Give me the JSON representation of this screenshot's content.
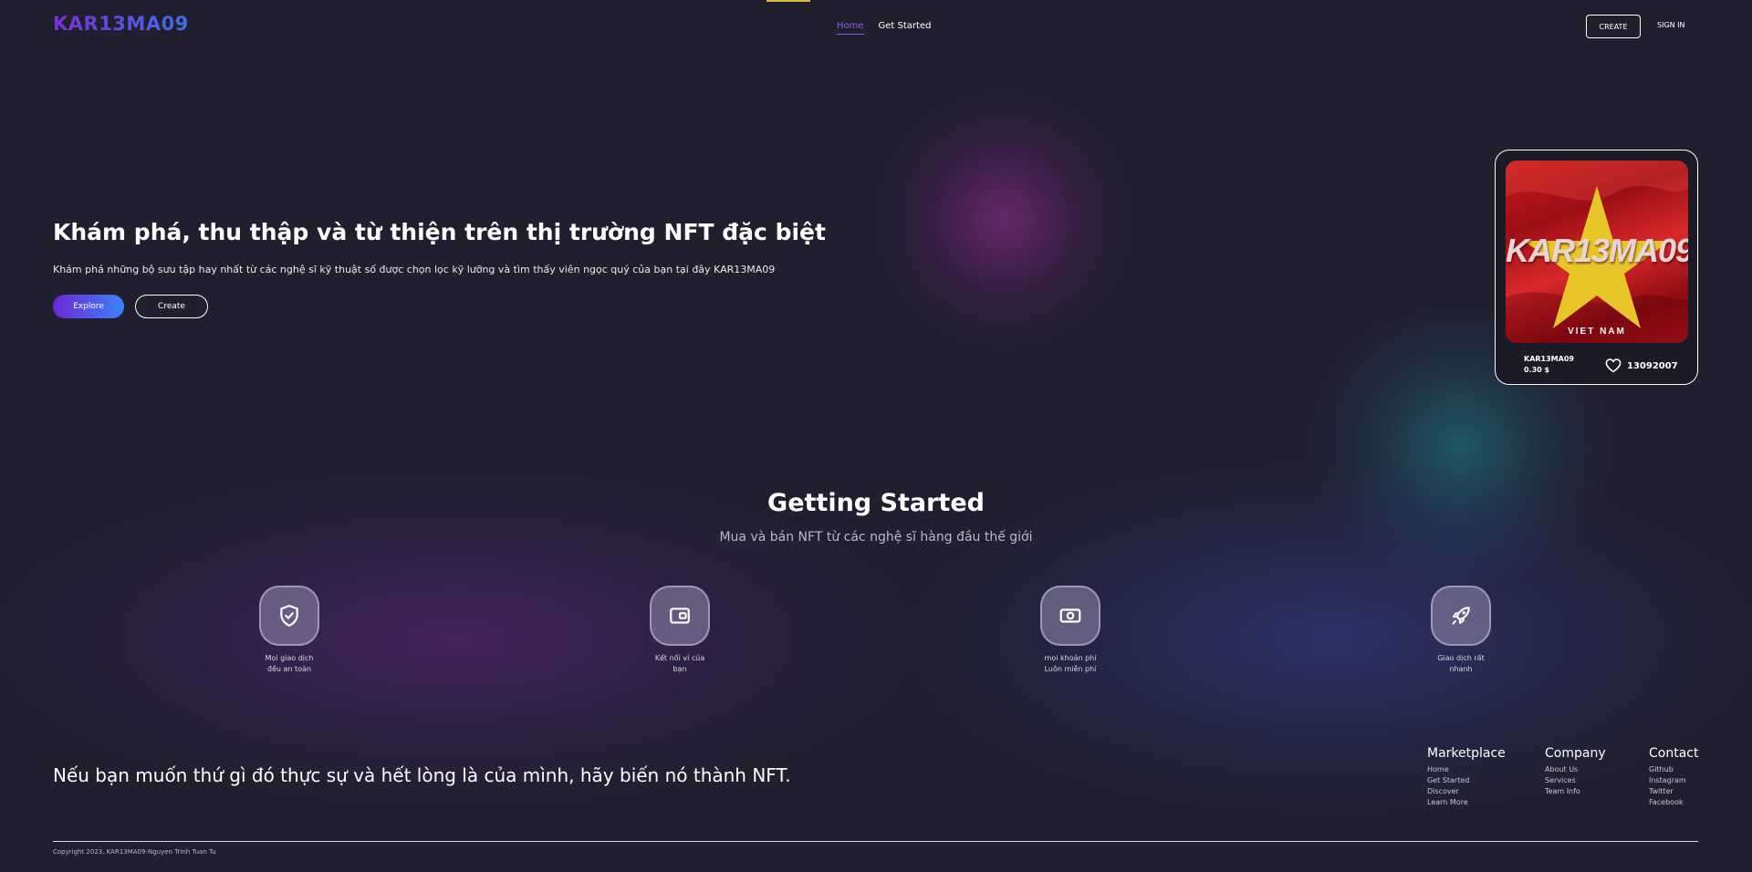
{
  "nav": {
    "logo": "KAR13MA09",
    "links": [
      {
        "label": "Home",
        "active": true
      },
      {
        "label": "Get Started",
        "active": false
      }
    ],
    "create_label": "CREATE",
    "signin_label": "SIGN IN"
  },
  "hero": {
    "title": "Khám phá, thu thập và từ thiện trên thị trường NFT đặc biệt",
    "subtitle": "Khám phá những bộ sưu tập hay nhất từ các nghệ sĩ kỹ thuật số được chọn lọc kỹ lưỡng và tìm thấy viên ngọc quý của bạn tại đây KAR13MA09",
    "explore_label": "Explore",
    "create_label": "Create"
  },
  "nft_card": {
    "art_title": "KAR13MA09",
    "art_subtitle": "VIET NAM",
    "name": "KAR13MA09",
    "price": "0.30 $",
    "likes": "13092007",
    "like_icon": "heart-icon"
  },
  "getting_started": {
    "title": "Getting Started",
    "subtitle": "Mua và bán NFT từ các nghệ sĩ hàng đầu thế giới",
    "features": [
      {
        "icon": "shield-check-icon",
        "label": "Mọi giao dịch đều an toàn"
      },
      {
        "icon": "wallet-icon",
        "label": "Kết nối ví của bạn"
      },
      {
        "icon": "money-icon",
        "label": "mọi khoản phí Luôn miễn phí"
      },
      {
        "icon": "rocket-icon",
        "label": "Giao dịch rất nhanh"
      }
    ]
  },
  "footer": {
    "tagline": "Nếu bạn muốn thứ gì đó thực sự và hết lòng là của mình, hãy biến nó thành NFT.",
    "columns": [
      {
        "title": "Marketplace",
        "links": [
          "Home",
          "Get Started",
          "Discover",
          "Learn More"
        ]
      },
      {
        "title": "Company",
        "links": [
          "About Us",
          "Services",
          "Team Info"
        ]
      },
      {
        "title": "Contact",
        "links": [
          "Github",
          "Instagram",
          "Twitter",
          "Facebook"
        ]
      }
    ],
    "copyright": "Copyright 2023, KAR13MA09-Nguyen Trinh Tuan Tu"
  },
  "colors": {
    "background": "#211f2f",
    "accent_purple": "#6d28d9",
    "accent_blue": "#3b82f6",
    "nav_active": "#8b5cf6"
  }
}
